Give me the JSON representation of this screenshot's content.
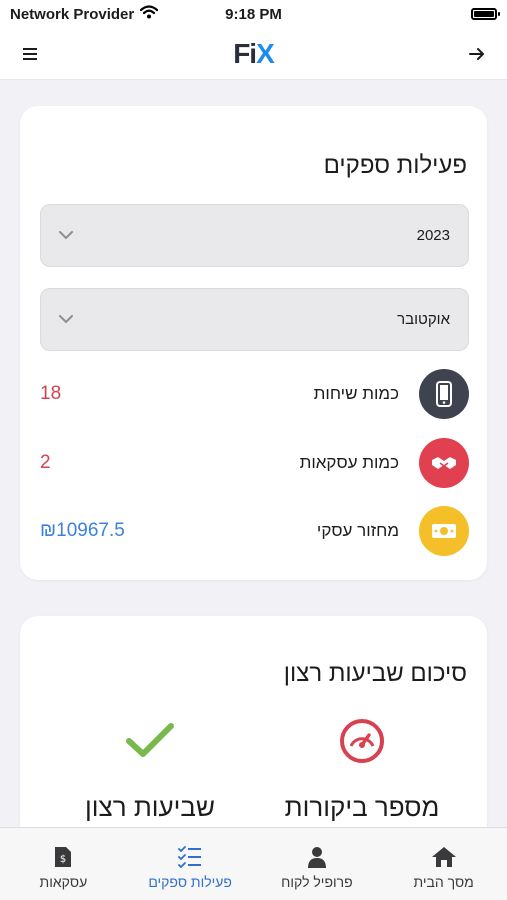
{
  "status_bar": {
    "carrier": "Network Provider",
    "time": "9:18 PM"
  },
  "header": {
    "logo_main": "Fi",
    "logo_accent": "X"
  },
  "supplier_activity": {
    "title": "פעילות ספקים",
    "year_select": {
      "value": "2023"
    },
    "month_select": {
      "value": "אוקטובר"
    },
    "stats": [
      {
        "label": "כמות שיחות",
        "value": "18",
        "icon": "phone-icon",
        "icon_color": "#3f4350",
        "value_color": "#d8414f"
      },
      {
        "label": "כמות עסקאות",
        "value": "2",
        "icon": "handshake-icon",
        "icon_color": "#e0404f",
        "value_color": "#d8414f"
      },
      {
        "label": "מחזור עסקי",
        "value": "₪10967.5",
        "icon": "money-icon",
        "icon_color": "#f5bf2a",
        "value_color": "#3a83d6"
      }
    ]
  },
  "satisfaction_summary": {
    "title": "סיכום שביעות רצון",
    "items": [
      {
        "label": "מספר ביקורות",
        "icon": "speedometer-icon",
        "color": "#d8414f"
      },
      {
        "label": "שביעות רצון",
        "icon": "checkmark-icon",
        "color": "#79b84a"
      }
    ]
  },
  "tab_bar": {
    "tabs": [
      {
        "label": "מסך הבית",
        "icon": "home-icon",
        "active": false
      },
      {
        "label": "פרופיל לקוח",
        "icon": "user-icon",
        "active": false
      },
      {
        "label": "פעילות ספקים",
        "icon": "checklist-icon",
        "active": true
      },
      {
        "label": "עסקאות",
        "icon": "invoice-icon",
        "active": false
      }
    ],
    "active_color": "#2f6fd0"
  }
}
